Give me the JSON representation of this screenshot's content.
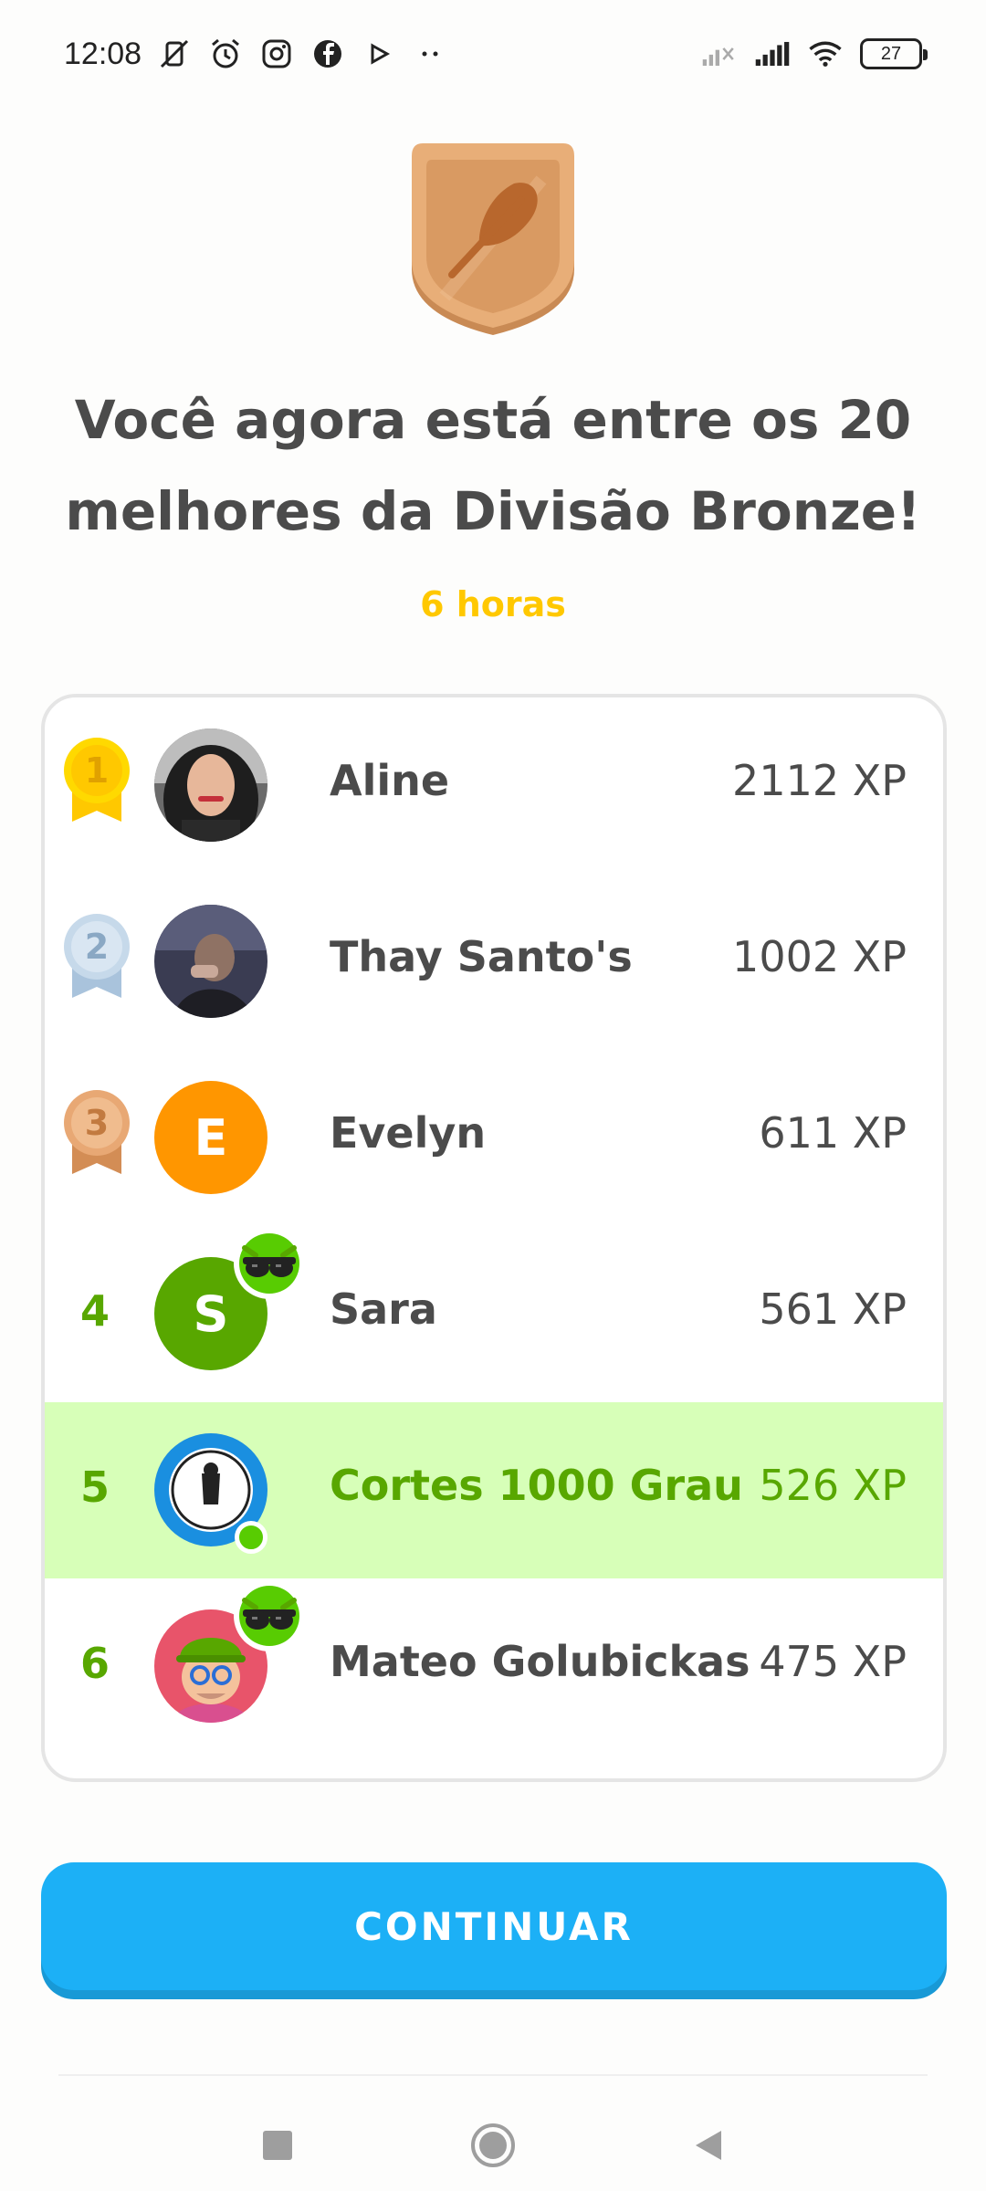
{
  "status_bar": {
    "time": "12:08",
    "battery": "27",
    "icons_left": [
      "mute-vibrate-icon",
      "alarm-icon",
      "instagram-icon",
      "facebook-icon",
      "play-icon",
      "more-dots-icon"
    ],
    "icons_right": [
      "signal-icon",
      "signal-icon",
      "wifi-icon",
      "battery-icon"
    ]
  },
  "header": {
    "headline_line1": "Você agora está entre os 20",
    "headline_line2": "melhores da Divisão Bronze!",
    "time_left": "6 horas"
  },
  "colors": {
    "bronze": "#d99a62",
    "gold": "#ffc800",
    "green": "#58a700",
    "highlight": "#d7ffb8",
    "button": "#1cb0f6"
  },
  "leaderboard": [
    {
      "rank": "1",
      "name": "Aline",
      "xp": "2112 XP",
      "avatar": "photo"
    },
    {
      "rank": "2",
      "name": "Thay Santo's",
      "xp": "1002 XP",
      "avatar": "photo"
    },
    {
      "rank": "3",
      "name": "Evelyn",
      "xp": "611 XP",
      "avatar_letter": "E"
    },
    {
      "rank": "4",
      "name": "Sara",
      "xp": "561 XP",
      "avatar_letter": "S"
    },
    {
      "rank": "5",
      "name": "Cortes 1000 Grau",
      "xp": "526 XP",
      "avatar": "logo",
      "current_user": true
    },
    {
      "rank": "6",
      "name": "Mateo Golubickas",
      "xp": "475 XP",
      "avatar": "character"
    }
  ],
  "actions": {
    "continue_label": "CONTINUAR"
  }
}
